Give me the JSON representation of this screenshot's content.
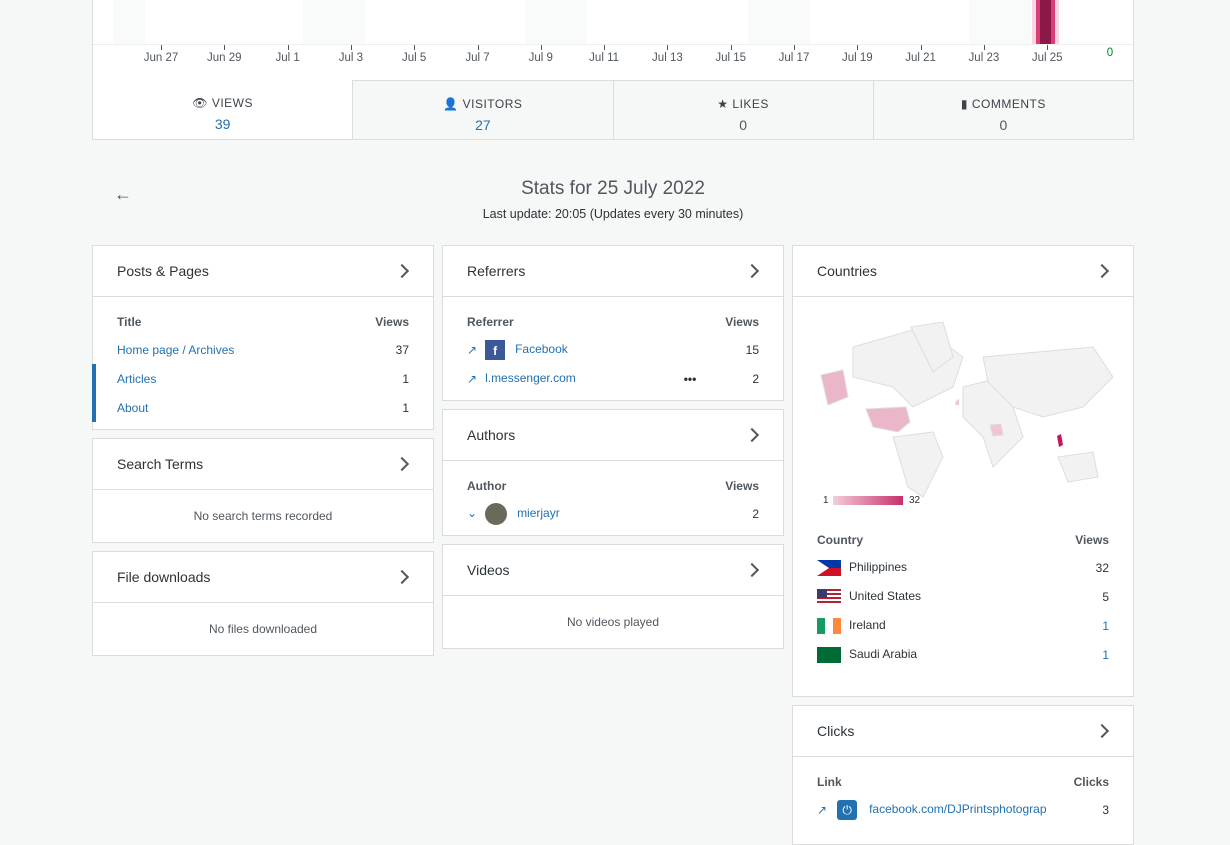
{
  "chart": {
    "ticks": [
      "Jun 27",
      "Jun 29",
      "Jul 1",
      "Jul 3",
      "Jul 5",
      "Jul 7",
      "Jul 9",
      "Jul 11",
      "Jul 13",
      "Jul 15",
      "Jul 17",
      "Jul 19",
      "Jul 21",
      "Jul 23",
      "Jul 25"
    ],
    "y_min_label": "0",
    "highlight_day": "Jul 25"
  },
  "tabs": [
    {
      "label": "VIEWS",
      "value": "39",
      "icon": "eye-icon"
    },
    {
      "label": "VISITORS",
      "value": "27",
      "icon": "person-icon"
    },
    {
      "label": "LIKES",
      "value": "0",
      "icon": "star-icon"
    },
    {
      "label": "COMMENTS",
      "value": "0",
      "icon": "comment-icon"
    }
  ],
  "header": {
    "title": "Stats for 25 July 2022",
    "subtitle": "Last update: 20:05 (Updates every 30 minutes)"
  },
  "posts": {
    "title": "Posts & Pages",
    "col1": "Title",
    "col2": "Views",
    "rows": [
      {
        "label": "Home page / Archives",
        "value": "37"
      },
      {
        "label": "Articles",
        "value": "1"
      },
      {
        "label": "About",
        "value": "1"
      }
    ]
  },
  "search": {
    "title": "Search Terms",
    "empty": "No search terms recorded"
  },
  "downloads": {
    "title": "File downloads",
    "empty": "No files downloaded"
  },
  "referrers": {
    "title": "Referrers",
    "col1": "Referrer",
    "col2": "Views",
    "rows": [
      {
        "label": "Facebook",
        "value": "15"
      },
      {
        "label": "l.messenger.com",
        "value": "2"
      }
    ]
  },
  "authors": {
    "title": "Authors",
    "col1": "Author",
    "col2": "Views",
    "rows": [
      {
        "label": "mierjayr",
        "value": "2"
      }
    ]
  },
  "videos": {
    "title": "Videos",
    "empty": "No videos played"
  },
  "countries": {
    "title": "Countries",
    "legend_min": "1",
    "legend_max": "32",
    "col1": "Country",
    "col2": "Views",
    "rows": [
      {
        "label": "Philippines",
        "value": "32"
      },
      {
        "label": "United States",
        "value": "5"
      },
      {
        "label": "Ireland",
        "value": "1"
      },
      {
        "label": "Saudi Arabia",
        "value": "1"
      }
    ]
  },
  "clicks": {
    "title": "Clicks",
    "col1": "Link",
    "col2": "Clicks",
    "rows": [
      {
        "label": "facebook.com/DJPrintsphotograp",
        "value": "3"
      }
    ]
  }
}
